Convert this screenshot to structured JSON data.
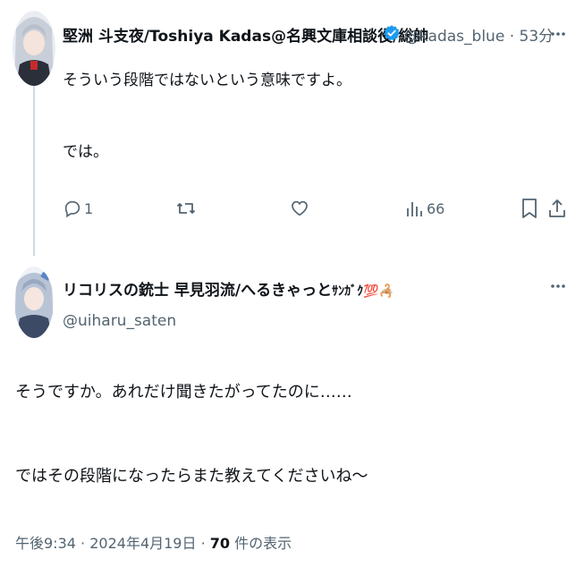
{
  "tweet1": {
    "display_name": "堅洲 斗支夜/Toshiya Kadas@名興文庫相談役/総帥",
    "handle": "@kadas_blue",
    "separator": "·",
    "time": "53分",
    "text_line1": "そういう段階ではないという意味ですよ。",
    "text_line2": "では。",
    "actions": {
      "reply_count": "1",
      "views_count": "66"
    },
    "verified": true
  },
  "tweet2": {
    "display_name": "リコリスの銃士 早見羽流/へるきゃっと",
    "name_emoji": "ｻﾝｶﾞｸ💯🦂",
    "handle": "@uiharu_saten",
    "text_line1": "そうですか。あれだけ聞きたがってたのに……",
    "text_line2": "ではその段階になったらまた教えてくださいね〜",
    "meta": {
      "time": "午後9:34",
      "separator1": "·",
      "date": "2024年4月19日",
      "separator2": "·",
      "views": "70",
      "views_label": "件の表示"
    }
  },
  "colors": {
    "text": "#0f1419",
    "secondary": "#536471",
    "verified": "#1d9bf0",
    "thread_line": "#cfd9de"
  },
  "icons": [
    "reply-icon",
    "retweet-icon",
    "like-icon",
    "views-icon",
    "bookmark-icon",
    "share-icon",
    "verified-badge-icon",
    "more-options-icon"
  ]
}
